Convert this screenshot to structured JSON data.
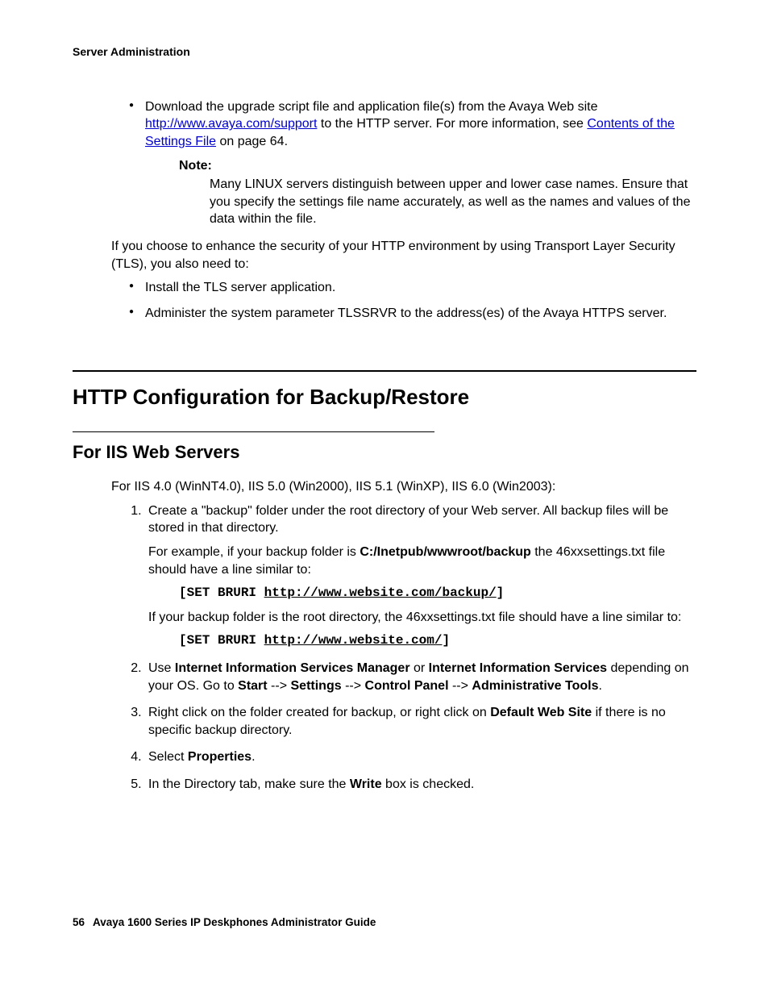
{
  "header": "Server Administration",
  "bullet1_pre": "Download the upgrade script file and application file(s) from the Avaya Web site ",
  "bullet1_link": "http://www.avaya.com/support",
  "bullet1_mid": " to the HTTP server. For more information, see ",
  "bullet1_xref": "Contents of the Settings File",
  "bullet1_post": " on page 64.",
  "note_label": "Note:",
  "note_text": "Many LINUX servers distinguish between upper and lower case names. Ensure that you specify the settings file name accurately, as well as the names and values of the data within the file.",
  "tls_intro": "If you choose to enhance the security of your HTTP environment by using Transport Layer Security (TLS), you also need to:",
  "tls_b1": "Install the TLS server application.",
  "tls_b2": "Administer the system parameter TLSSRVR to the address(es) of the Avaya HTTPS server.",
  "h1": "HTTP Configuration for Backup/Restore",
  "h2": "For IIS Web Servers",
  "iis_intro": "For IIS 4.0 (WinNT4.0), IIS 5.0 (Win2000), IIS 5.1 (WinXP), IIS 6.0 (Win2003):",
  "s1_p1": "Create a \"backup\" folder under the root directory of your Web server. All backup files will be stored in that directory.",
  "s1_p2_pre": "For example, if your backup folder is ",
  "s1_p2_bold": "C:/Inetpub/wwwroot/backup",
  "s1_p2_post": " the 46xxsettings.txt file should have a line similar to:",
  "s1_code1_a": "[SET BRURI ",
  "s1_code1_b": "http://www.website.com/backup/",
  "s1_code1_c": "]",
  "s1_p3": "If your backup folder is the root directory, the 46xxsettings.txt file should have a line similar to:",
  "s1_code2_a": "[SET BRURI ",
  "s1_code2_b": "http://www.website.com/",
  "s1_code2_c": "]",
  "s2_a": "Use ",
  "s2_b1": "Internet Information Services Manager",
  "s2_b": " or ",
  "s2_b2": "Internet Information Services",
  "s2_c": " depending on your OS. Go to ",
  "s2_b3": "Start",
  "s2_d": " --> ",
  "s2_b4": "Settings",
  "s2_b5": "Control Panel",
  "s2_b6": "Administrative Tools",
  "s2_e": ".",
  "s3_a": "Right click on the folder created for backup, or right click on ",
  "s3_b": "Default Web Site",
  "s3_c": " if there is no specific backup directory.",
  "s4_a": "Select ",
  "s4_b": "Properties",
  "s4_c": ".",
  "s5_a": "In the Directory tab, make sure the ",
  "s5_b": "Write",
  "s5_c": " box is checked.",
  "page_number": "56",
  "footer_title": "Avaya 1600 Series IP Deskphones Administrator Guide"
}
